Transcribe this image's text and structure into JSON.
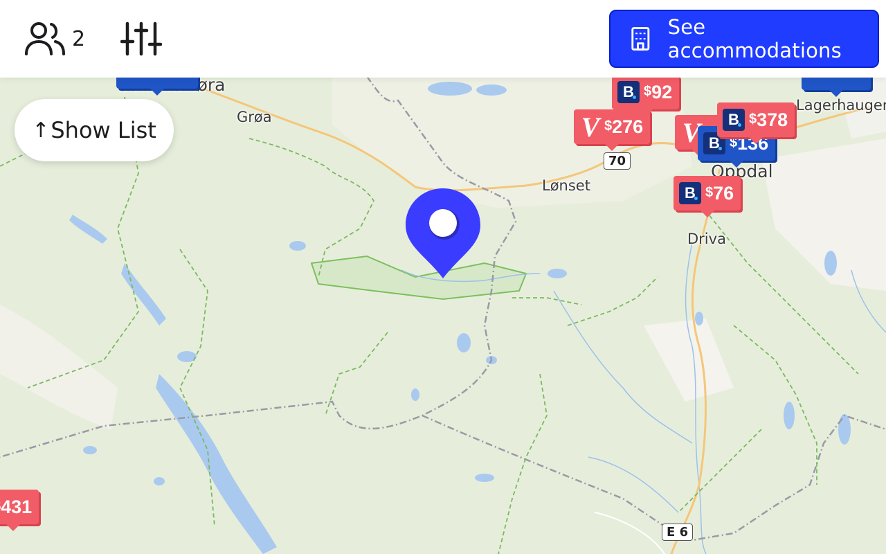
{
  "header": {
    "guests_icon": "users-icon",
    "guests_count": "2",
    "filters_icon": "sliders-icon",
    "cta_icon": "building-icon",
    "cta_label": "See accommodations",
    "cta_color": "#1f3cff"
  },
  "show_list": {
    "arrow": "↑",
    "label": "Show List"
  },
  "map": {
    "places": {
      "top_left": "Sunndalsøra",
      "groa": "Grøa",
      "lonset": "Lønset",
      "oppdal": "Oppdal",
      "driva": "Driva",
      "lagerhaugen": "Lagerhaugen"
    },
    "roads": {
      "r70": "70",
      "e6": "E 6"
    },
    "selected_pin_color": "#3a3dff"
  },
  "markers": [
    {
      "id": "m92",
      "price": "92",
      "currency": "$",
      "brand": "booking",
      "color": "#f25c66"
    },
    {
      "id": "m276",
      "price": "276",
      "currency": "$",
      "brand": "vrbo",
      "color": "#f25c66"
    },
    {
      "id": "m378",
      "price": "378",
      "currency": "$",
      "brand": "booking",
      "color": "#f25c66"
    },
    {
      "id": "m136",
      "price": "136",
      "currency": "$",
      "brand": "booking",
      "color": "#1f55c6"
    },
    {
      "id": "m76",
      "price": "76",
      "currency": "$",
      "brand": "booking",
      "color": "#f25c66"
    },
    {
      "id": "m431",
      "price": "431",
      "currency": "$",
      "brand": "booking",
      "color": "#f25c66"
    }
  ]
}
